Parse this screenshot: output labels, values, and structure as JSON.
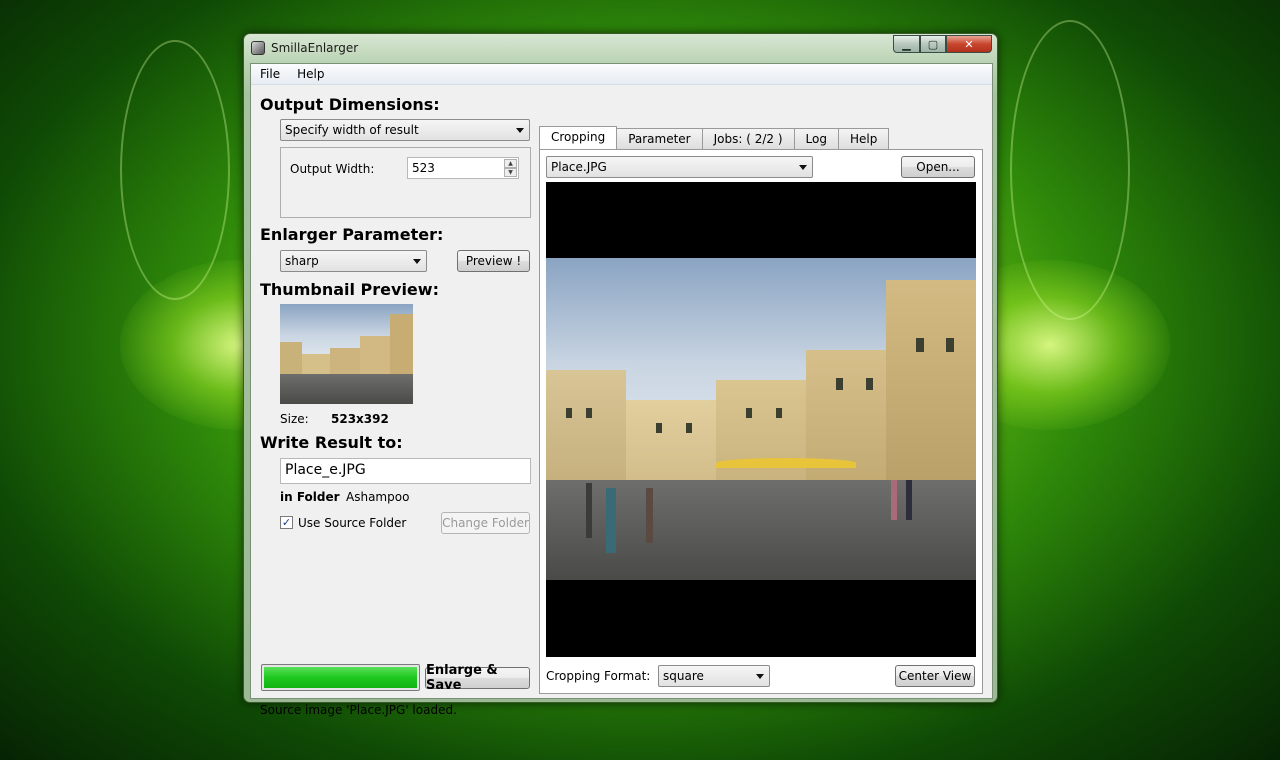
{
  "window": {
    "title": "SmillaEnlarger"
  },
  "menu": [
    "File",
    "Help"
  ],
  "left": {
    "output_dimensions_heading": "Output Dimensions:",
    "dimension_mode": "Specify width of result",
    "output_width_label": "Output Width:",
    "output_width_value": "523",
    "enlarger_parameter_heading": "Enlarger Parameter:",
    "enlarger_preset": "sharp",
    "preview_button": "Preview !",
    "thumbnail_heading": "Thumbnail Preview:",
    "size_label": "Size:",
    "size_value": "523x392",
    "write_result_heading": "Write Result to:",
    "result_filename": "Place_e.JPG",
    "in_folder_label": "in Folder",
    "folder_name": "Ashampoo",
    "use_source_folder_label": "Use Source Folder",
    "use_source_folder_checked": true,
    "change_folder_button": "Change Folder",
    "progress_fraction": 1.0,
    "enlarge_save_button": "Enlarge & Save",
    "status_text": "Source image 'Place.JPG' loaded."
  },
  "tabs": [
    {
      "label": "Cropping",
      "active": true
    },
    {
      "label": "Parameter",
      "active": false
    },
    {
      "label": "Jobs: ( 2/2 )",
      "active": false
    },
    {
      "label": "Log",
      "active": false
    },
    {
      "label": "Help",
      "active": false
    }
  ],
  "cropping": {
    "source_file": "Place.JPG",
    "open_button": "Open...",
    "cropping_format_label": "Cropping Format:",
    "cropping_format_value": "square",
    "center_view_button": "Center View"
  },
  "colors": {
    "progress": "#1ec81e",
    "desktop": "#2f8a0a"
  }
}
